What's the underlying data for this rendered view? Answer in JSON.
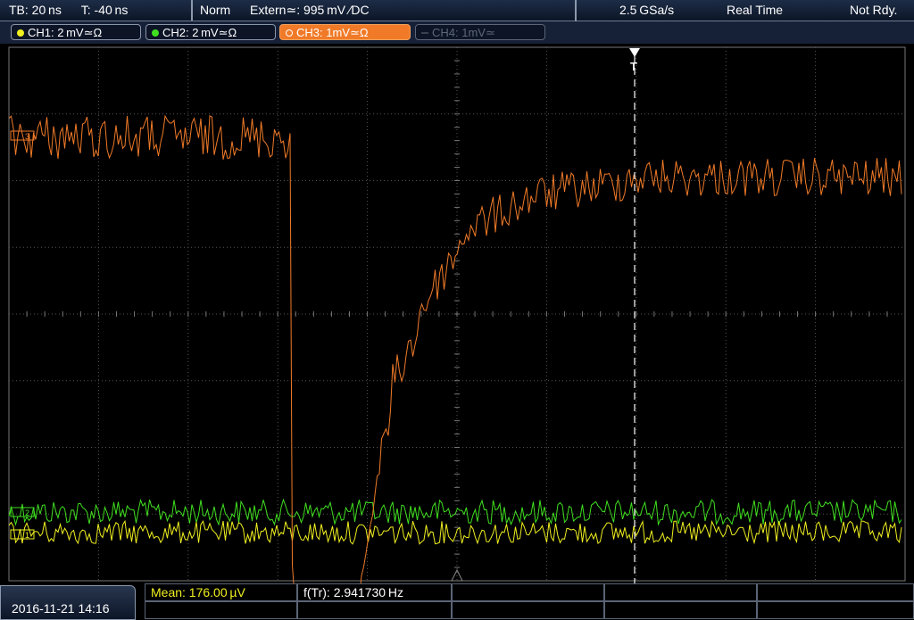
{
  "status_bar": {
    "timebase": "TB: 20 ns",
    "trigger_pos": "T: -40 ns",
    "trigger_mode": "Norm",
    "trigger_source": "Extern≃: 995 mV ∕DC",
    "sample_rate": "2.5 GSa/s",
    "acq_mode": "Real Time",
    "status": "Not Rdy."
  },
  "channels": [
    {
      "label": "CH1: 2 mV≃Ω",
      "color": "#f0f020",
      "state": "on"
    },
    {
      "label": "CH2: 2 mV≃Ω",
      "color": "#40e020",
      "state": "on"
    },
    {
      "label": "CH3: 1mV≃Ω",
      "color": "#f07a28",
      "state": "active"
    },
    {
      "label": "CH4: 1mV≃",
      "color": "#5e6777",
      "state": "off"
    }
  ],
  "markers": {
    "ch1": "1",
    "ch2": "2",
    "ch3": "3",
    "trigger": "T"
  },
  "colors": {
    "ch1": "#f0f020",
    "ch2": "#40e020",
    "ch3": "#f07a28",
    "grid": "#6a6a6a",
    "trigger": "#ffffff"
  },
  "footer": {
    "datetime": "2016-11-21 14:16",
    "meas1": "Mean: 176.00 µV",
    "meas2": "f(Tr): 2.941730 Hz"
  }
}
